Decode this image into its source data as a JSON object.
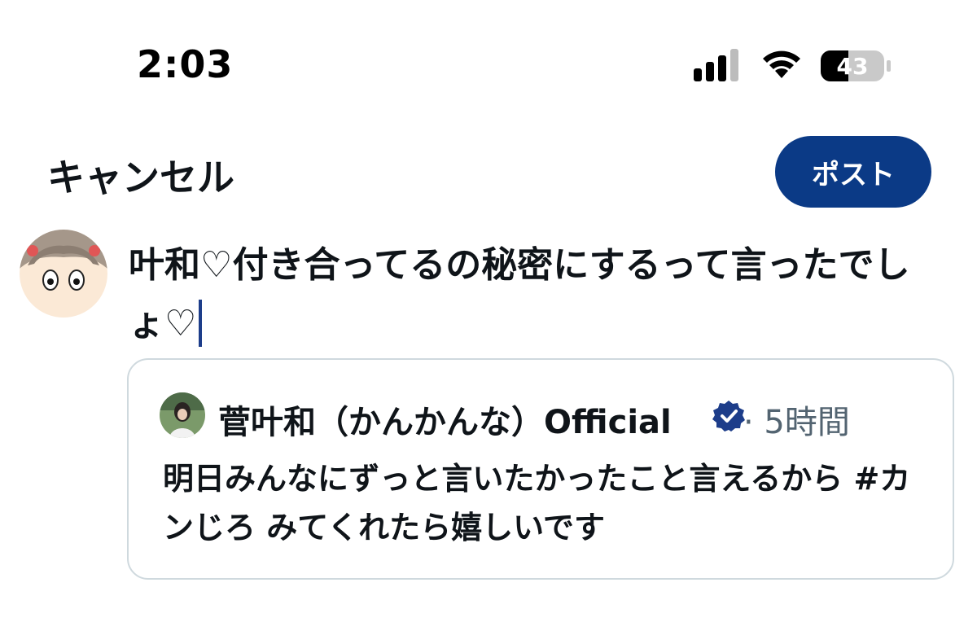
{
  "status_bar": {
    "time": "2:03",
    "battery_percent": "43",
    "signal_icon": "cellular-signal-icon",
    "wifi_icon": "wifi-icon"
  },
  "header": {
    "cancel_label": "キャンセル",
    "post_label": "ポスト"
  },
  "compose": {
    "text": "叶和♡付き合ってるの秘密にするって言ったでしょ♡"
  },
  "quote": {
    "author_name": "菅叶和（かんかんな）Official",
    "verified_icon": "verified-badge-icon",
    "time": "· 5時間",
    "text": "明日みんなにずっと言いたかったこと言えるから #カンじろ みてくれたら嬉しいです"
  },
  "colors": {
    "post_button": "#0b3a86",
    "verified": "#1d9bf0",
    "muted_text": "#536471",
    "border": "#cfd9de"
  }
}
